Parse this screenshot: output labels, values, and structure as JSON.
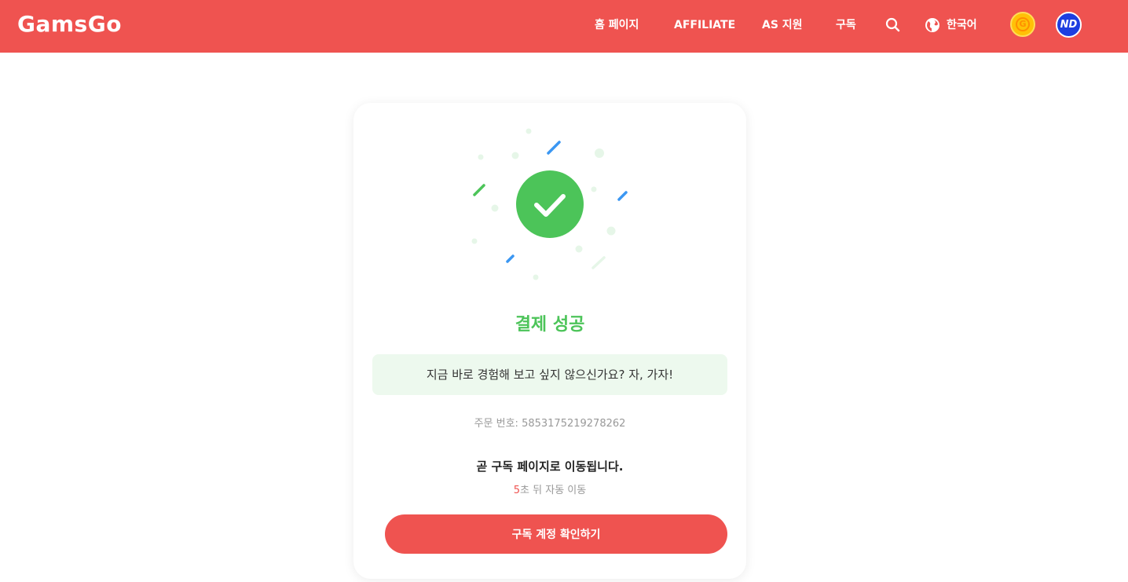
{
  "header": {
    "logo": "GamsGo",
    "nav": {
      "home": "홈 페이지",
      "affiliate": "AFFILIATE",
      "support": "AS 지원",
      "subscribe": "구독"
    },
    "language": "한국어",
    "coin_icon": "G",
    "avatar_initials": "ND",
    "brand_color": "#ef5350"
  },
  "main": {
    "success_title": "결제 성공",
    "promo_text": "지금 바로 경험해 보고 싶지 않으신가요? 자, 가자!",
    "order_label": "주문 번호: ",
    "order_number": "5853175219278262",
    "redirect_text": "곧 구독 페이지로 이동됩니다.",
    "countdown_number": "5",
    "countdown_suffix": "초 뒤 자동 이동",
    "cta_label": "구독 계정 확인하기",
    "success_color": "#4cc459"
  }
}
